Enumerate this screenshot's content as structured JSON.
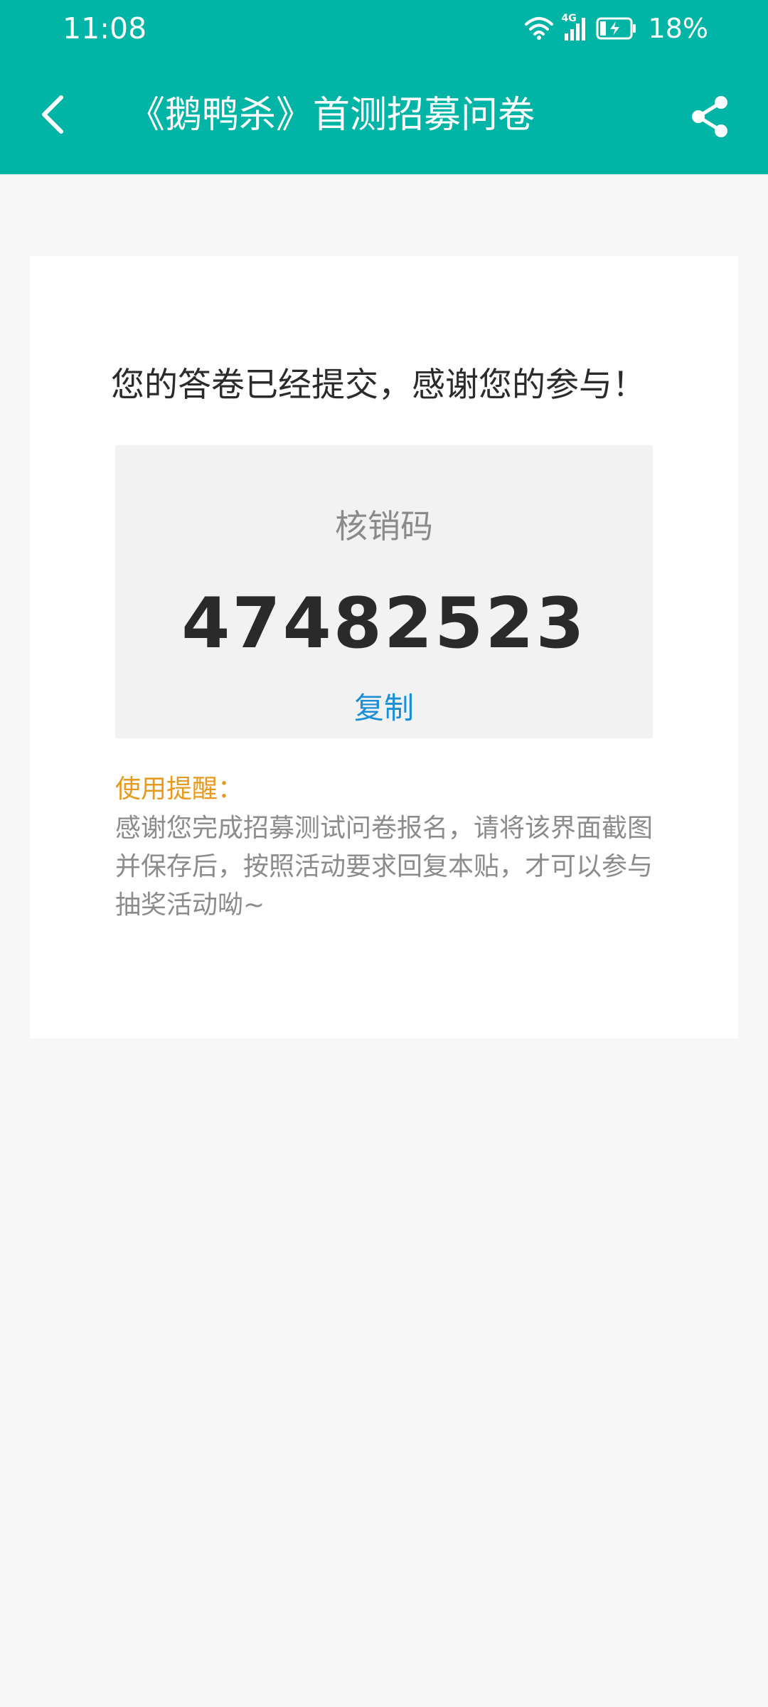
{
  "status_bar": {
    "time": "11:08",
    "network_type": "4G",
    "battery_percent": "18%",
    "icons": [
      "wifi-icon",
      "cellular-signal-icon",
      "battery-charging-icon"
    ]
  },
  "header": {
    "title": "《鹅鸭杀》首测招募问卷",
    "back_icon": "chevron-left-icon",
    "share_icon": "share-icon",
    "background_color": "#00b4a6"
  },
  "result_card": {
    "message": "您的答卷已经提交，感谢您的参与！",
    "code_label": "核销码",
    "code_value": "47482523",
    "copy_label": "复制",
    "tip_title": "使用提醒：",
    "tip_body": "感谢您完成招募测试问卷报名，请将该界面截图并保存后，按照活动要求回复本贴，才可以参与抽奖活动呦~"
  },
  "colors": {
    "accent": "#00b4a6",
    "link": "#1a8fd8",
    "tip_title": "#e89a1e"
  }
}
